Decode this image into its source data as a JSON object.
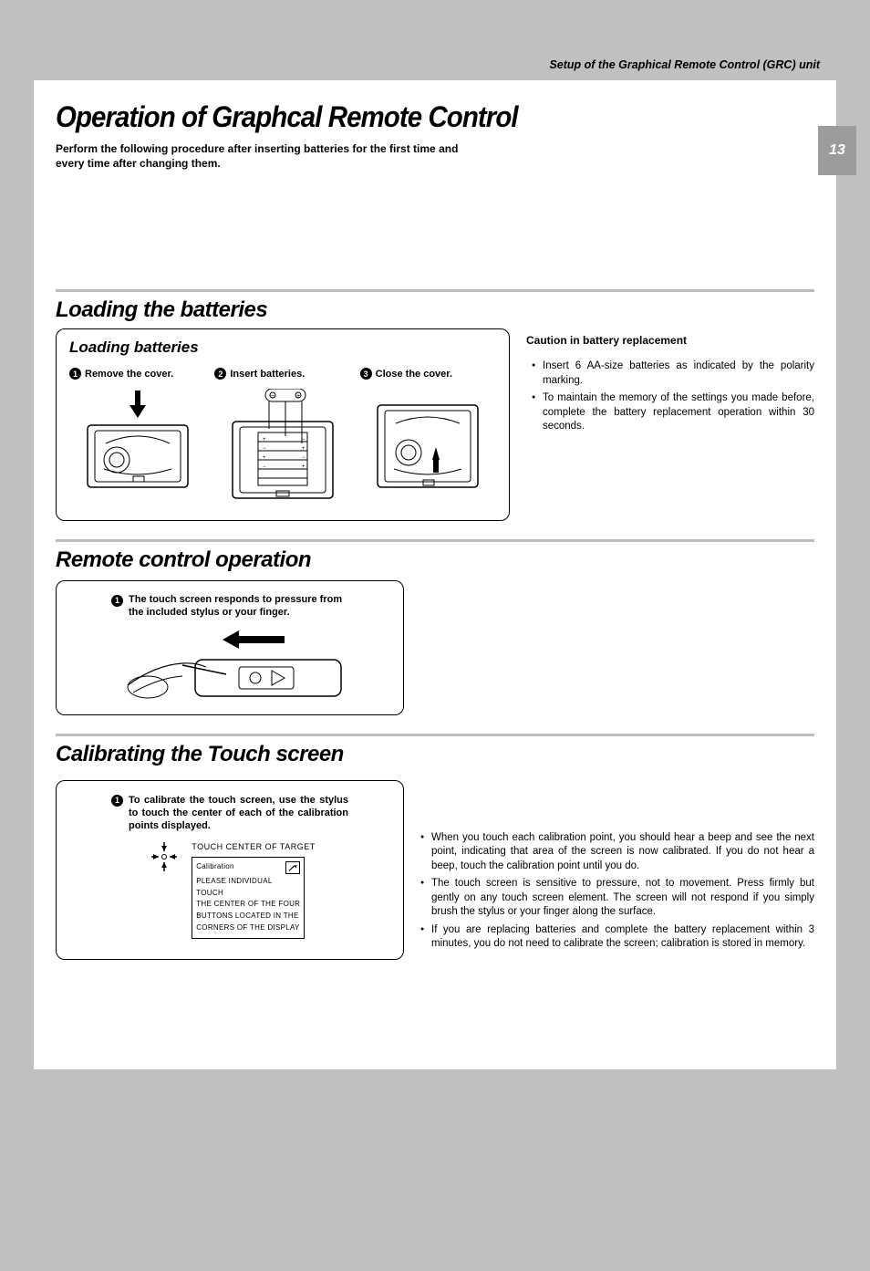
{
  "header": {
    "tagline": "Setup of the Graphical Remote Control (GRC) unit"
  },
  "page_number": "13",
  "main_title": "Operation of Graphcal Remote Control",
  "intro": "Perform the following procedure after inserting batteries for the first time and every time after changing them.",
  "section1": {
    "heading": "Loading the batteries",
    "sub_heading": "Loading batteries",
    "steps": [
      {
        "num": "1",
        "label": "Remove the cover."
      },
      {
        "num": "2",
        "label": "Insert batteries."
      },
      {
        "num": "3",
        "label": "Close the cover."
      }
    ],
    "caution_heading": "Caution in battery replacement",
    "caution_items": [
      "Insert 6 AA-size batteries as indicated by the polarity marking.",
      "To maintain the memory of the settings you made before, complete the battery replacement operation within 30 seconds."
    ]
  },
  "section2": {
    "heading": "Remote control operation",
    "caption_num": "1",
    "caption": "The touch screen responds to pressure from the included stylus or your finger."
  },
  "section3": {
    "heading": "Calibrating the Touch screen",
    "caption_num": "1",
    "caption": "To calibrate the touch screen, use the stylus to touch the center of each of the calibration points displayed.",
    "target_label": "TOUCH CENTER OF TARGET",
    "screen": {
      "line1": "Calibration",
      "line2": "PLEASE INDIVIDUAL TOUCH",
      "line3": "THE CENTER OF THE FOUR",
      "line4": "BUTTONS LOCATED IN THE",
      "line5": "CORNERS OF THE DISPLAY"
    },
    "notes": [
      "When you touch each calibration point, you should hear a beep and see the next point, indicating that area of the screen is now calibrated. If you do not hear a beep, touch the calibration point until you do.",
      "The touch screen is sensitive to pressure, not to movement. Press firmly but gently on any touch screen element. The screen will not respond if you simply brush the stylus or your finger along the surface.",
      "If you are replacing batteries and complete the battery replacement within 3 minutes, you do not need to calibrate the screen; calibration is stored in memory."
    ]
  }
}
